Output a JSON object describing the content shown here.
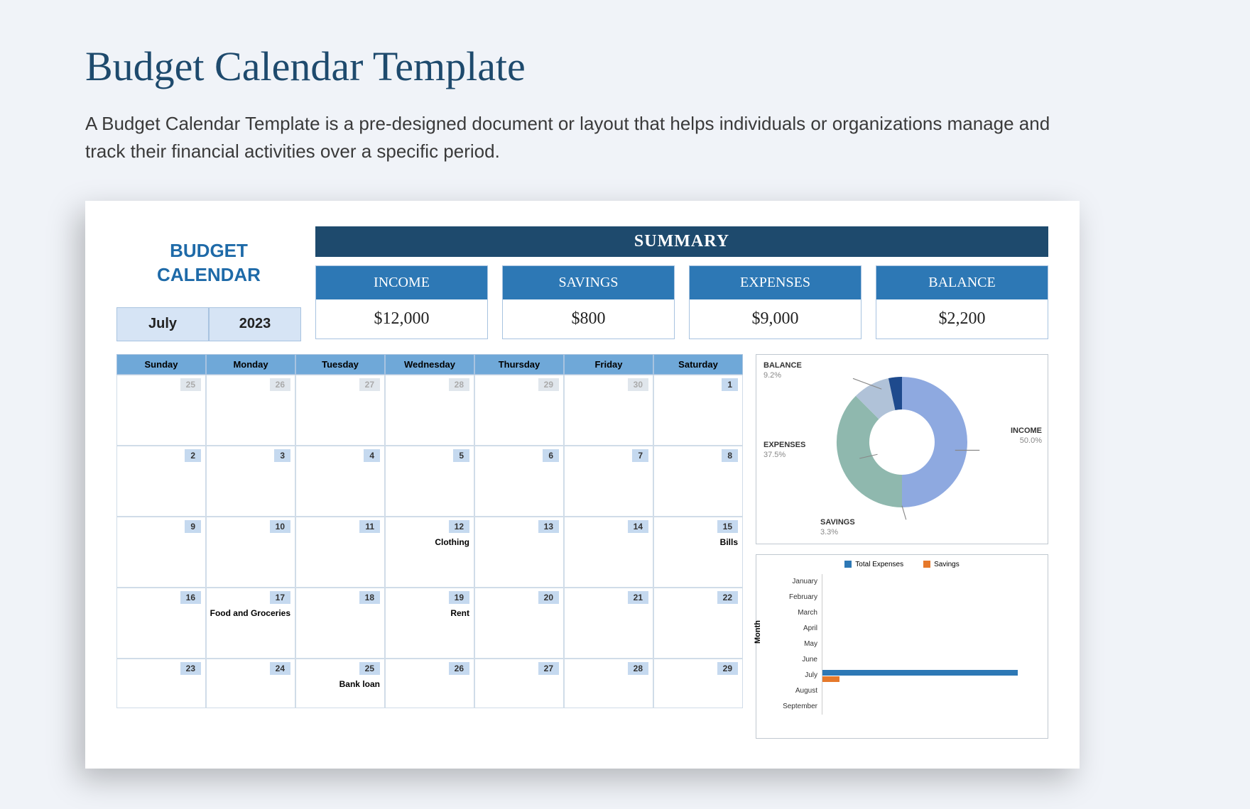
{
  "page": {
    "title": "Budget Calendar Template",
    "description": "A Budget Calendar Template is a pre-designed document or layout that helps individuals or organizations manage and track their financial activities over a specific period."
  },
  "header": {
    "budget_calendar": "BUDGET CALENDAR",
    "month": "July",
    "year": "2023"
  },
  "summary": {
    "title": "SUMMARY",
    "cards": [
      {
        "label": "INCOME",
        "value": "$12,000"
      },
      {
        "label": "SAVINGS",
        "value": "$800"
      },
      {
        "label": "EXPENSES",
        "value": "$9,000"
      },
      {
        "label": "BALANCE",
        "value": "$2,200"
      }
    ]
  },
  "calendar": {
    "days": [
      "Sunday",
      "Monday",
      "Tuesday",
      "Wednesday",
      "Thursday",
      "Friday",
      "Saturday"
    ],
    "weeks": [
      [
        {
          "n": "25",
          "muted": true
        },
        {
          "n": "26",
          "muted": true
        },
        {
          "n": "27",
          "muted": true
        },
        {
          "n": "28",
          "muted": true
        },
        {
          "n": "29",
          "muted": true
        },
        {
          "n": "30",
          "muted": true
        },
        {
          "n": "1"
        }
      ],
      [
        {
          "n": "2"
        },
        {
          "n": "3"
        },
        {
          "n": "4"
        },
        {
          "n": "5"
        },
        {
          "n": "6"
        },
        {
          "n": "7"
        },
        {
          "n": "8"
        }
      ],
      [
        {
          "n": "9"
        },
        {
          "n": "10"
        },
        {
          "n": "11"
        },
        {
          "n": "12",
          "event": "Clothing"
        },
        {
          "n": "13"
        },
        {
          "n": "14"
        },
        {
          "n": "15",
          "event": "Bills"
        }
      ],
      [
        {
          "n": "16"
        },
        {
          "n": "17",
          "event": "Food and Groceries"
        },
        {
          "n": "18"
        },
        {
          "n": "19",
          "event": "Rent"
        },
        {
          "n": "20"
        },
        {
          "n": "21"
        },
        {
          "n": "22"
        }
      ],
      [
        {
          "n": "23"
        },
        {
          "n": "24"
        },
        {
          "n": "25",
          "event": "Bank loan"
        },
        {
          "n": "26"
        },
        {
          "n": "27"
        },
        {
          "n": "28"
        },
        {
          "n": "29"
        }
      ]
    ]
  },
  "chart_data": [
    {
      "type": "pie",
      "title": "",
      "series": [
        {
          "name": "INCOME",
          "value": 50.0,
          "color": "#8ea9e0"
        },
        {
          "name": "EXPENSES",
          "value": 37.5,
          "color": "#8fb8ae"
        },
        {
          "name": "BALANCE",
          "value": 9.2,
          "color": "#b0c2d8"
        },
        {
          "name": "SAVINGS",
          "value": 3.3,
          "color": "#1e4a8d"
        }
      ]
    },
    {
      "type": "bar",
      "orientation": "horizontal",
      "ylabel": "Month",
      "legend": [
        "Total Expenses",
        "Savings"
      ],
      "legend_colors": [
        "#2d78b5",
        "#e6792b"
      ],
      "categories": [
        "January",
        "February",
        "March",
        "April",
        "May",
        "June",
        "July",
        "August",
        "September"
      ],
      "series": [
        {
          "name": "Total Expenses",
          "values": [
            0,
            0,
            0,
            0,
            0,
            0,
            9000,
            0,
            0
          ]
        },
        {
          "name": "Savings",
          "values": [
            0,
            0,
            0,
            0,
            0,
            0,
            800,
            0,
            0
          ]
        }
      ],
      "xlim": [
        0,
        10000
      ]
    }
  ],
  "donut_labels": {
    "balance": "BALANCE",
    "balance_pct": "9.2%",
    "income": "INCOME",
    "income_pct": "50.0%",
    "expenses": "EXPENSES",
    "expenses_pct": "37.5%",
    "savings": "SAVINGS",
    "savings_pct": "3.3%"
  }
}
